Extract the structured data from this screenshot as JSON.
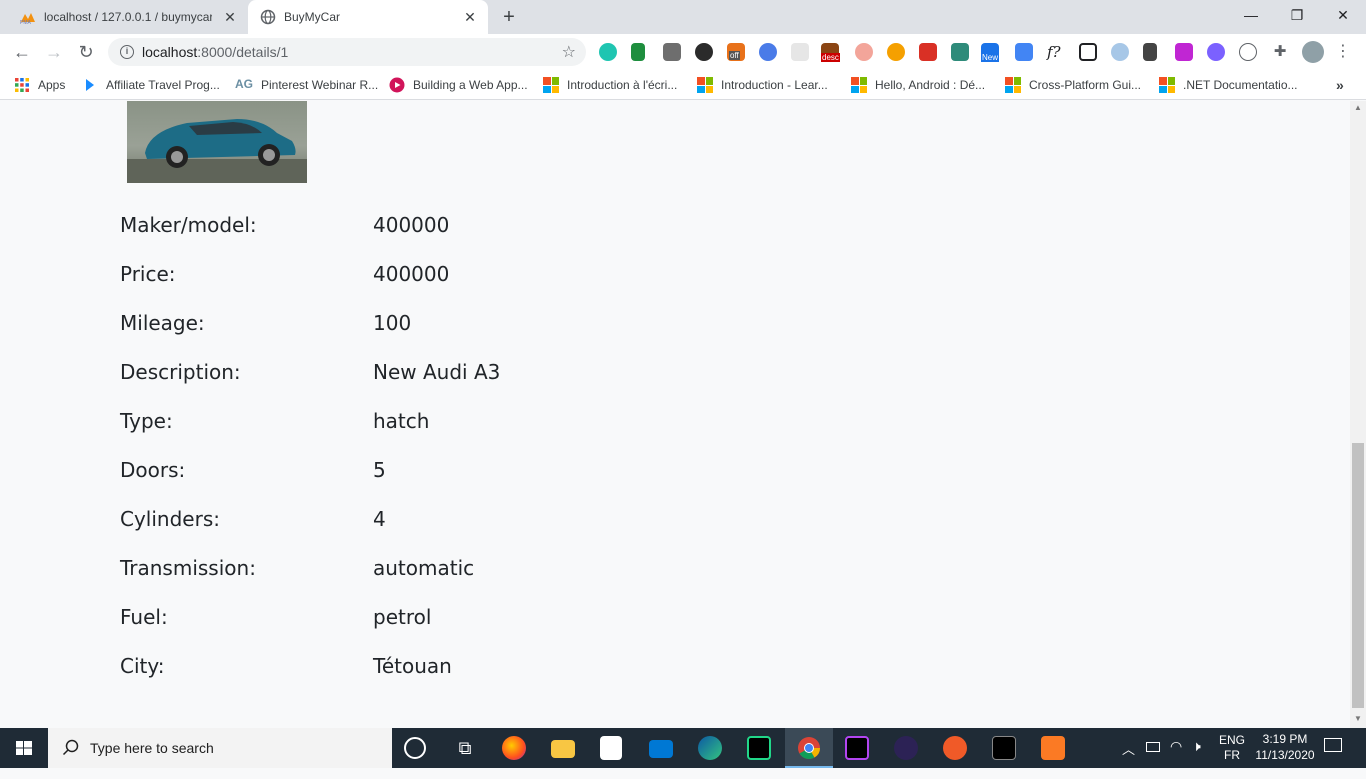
{
  "browser": {
    "tabs": [
      {
        "title": "localhost / 127.0.0.1 / buymycar /",
        "icon": "phpmyadmin-icon",
        "active": false
      },
      {
        "title": "BuyMyCar",
        "icon": "globe-icon",
        "active": true
      }
    ],
    "address": {
      "host": "localhost",
      "path": ":8000/details/1"
    },
    "bookmarks": [
      {
        "label": "Apps",
        "icon": "apps-grid-icon"
      },
      {
        "label": "Affiliate Travel Prog...",
        "icon": "travel-icon"
      },
      {
        "label": "Pinterest Webinar R...",
        "icon": "ag-icon",
        "icon_text": "AG"
      },
      {
        "label": "Building a Web App...",
        "icon": "video-icon"
      },
      {
        "label": "Introduction à l'écri...",
        "icon": "microsoft-icon"
      },
      {
        "label": "Introduction - Lear...",
        "icon": "microsoft-icon"
      },
      {
        "label": "Hello, Android : Dé...",
        "icon": "microsoft-icon"
      },
      {
        "label": "Cross-Platform Gui...",
        "icon": "microsoft-icon"
      },
      {
        "label": ".NET Documentatio...",
        "icon": "microsoft-icon"
      }
    ],
    "more_bookmarks": "»",
    "extension_badges": {
      "off": "off",
      "desc": "desc",
      "new": "New",
      "font": "f?"
    }
  },
  "car": {
    "image_alt": "Audi A3 hatchback",
    "details": [
      {
        "label": "Maker/model:",
        "value": "400000"
      },
      {
        "label": "Price:",
        "value": "400000"
      },
      {
        "label": "Mileage:",
        "value": "100"
      },
      {
        "label": "Description:",
        "value": "New Audi A3"
      },
      {
        "label": "Type:",
        "value": "hatch"
      },
      {
        "label": "Doors:",
        "value": "5"
      },
      {
        "label": "Cylinders:",
        "value": "4"
      },
      {
        "label": "Transmission:",
        "value": "automatic"
      },
      {
        "label": "Fuel:",
        "value": "petrol"
      },
      {
        "label": "City:",
        "value": "Tétouan"
      }
    ]
  },
  "taskbar": {
    "search_placeholder": "Type here to search",
    "lang_top": "ENG",
    "lang_bottom": "FR",
    "time": "3:19 PM",
    "date": "11/13/2020"
  },
  "colors": {
    "tabstrip": "#dee1e6",
    "taskbar": "#1f2b36",
    "page_bg": "#f8f9fa",
    "text": "#212529"
  }
}
